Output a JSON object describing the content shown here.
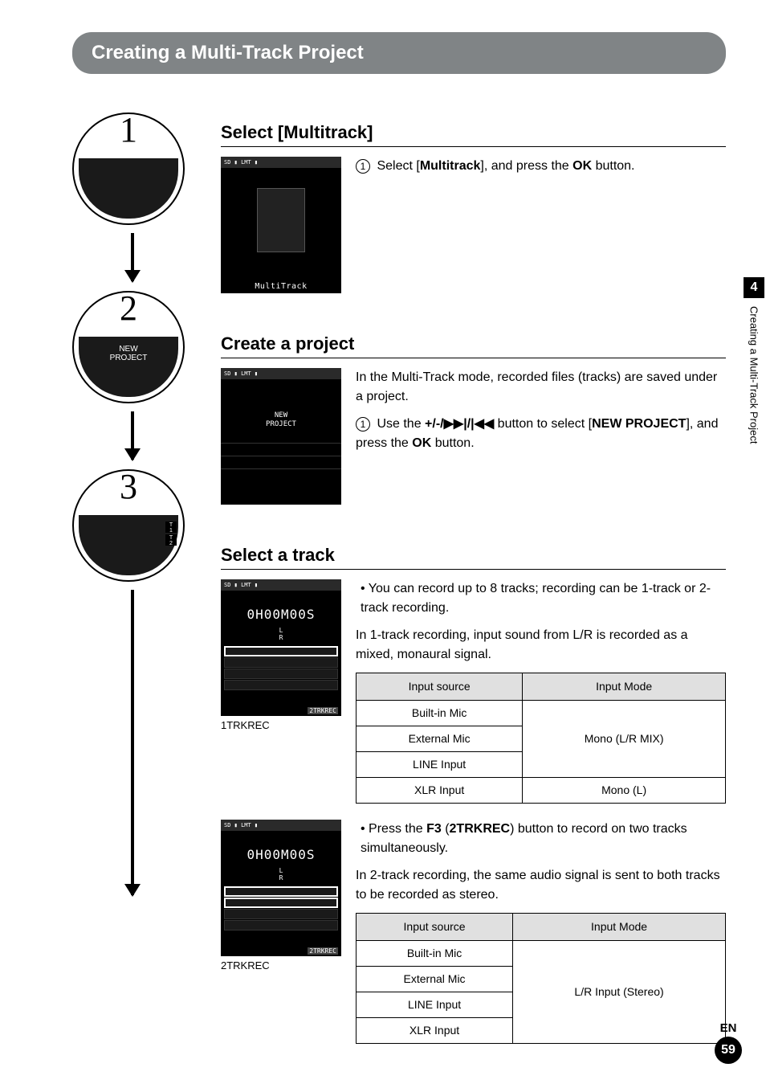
{
  "header": {
    "title": "Creating a Multi-Track Project"
  },
  "side": {
    "chapter_num": "4",
    "chapter_title": "Creating a Multi-Track Project"
  },
  "footer": {
    "lang": "EN",
    "page": "59"
  },
  "steps": {
    "s1": {
      "num": "1"
    },
    "s2": {
      "num": "2",
      "screen_label": "NEW\nPROJECT"
    },
    "s3": {
      "num": "3",
      "t1": "T\n1",
      "t2": "T\n2"
    }
  },
  "sec1": {
    "title": "Select [Multitrack]",
    "screen_footer": "MultiTrack",
    "step_num": "1",
    "text_pre": "Select [",
    "text_bold": "Multitrack",
    "text_mid": "], and press the ",
    "text_ok": "OK",
    "text_post": " button."
  },
  "sec2": {
    "title": "Create a project",
    "intro": "In the Multi-Track mode, recorded files (tracks) are saved under a project.",
    "step_num": "1",
    "text_pre": "Use the ",
    "btn_seq": "+/-/▶▶|/|◀◀",
    "text_mid": " button to select [",
    "text_bold": "NEW PROJECT",
    "text_mid2": "], and press the ",
    "text_ok": "OK",
    "text_post": " button.",
    "screen_np": "NEW\nPROJECT"
  },
  "sec3": {
    "title": "Select a track",
    "bullet1": "You can record up to 8 tracks; recording can be 1-track or 2-track recording.",
    "para1": "In 1-track recording, input sound from L/R is recorded as a mixed, monaural signal.",
    "screen1_time": "0H00M00S",
    "screen1_lr": "L\nR",
    "screen1_bottom": "2TRKREC",
    "cap1": "1TRKREC",
    "bullet2_pre": "Press the ",
    "bullet2_f3": "F3",
    "bullet2_mid": " (",
    "bullet2_bold": "2TRKREC",
    "bullet2_post": ") button to record on two tracks simultaneously.",
    "para2": "In 2-track recording, the same audio signal is sent to both tracks to be recorded as stereo.",
    "screen2_time": "0H00M00S",
    "cap2": "2TRKREC",
    "table1": {
      "h1": "Input source",
      "h2": "Input Mode",
      "r1": "Built-in Mic",
      "r2": "External Mic",
      "r3": "LINE Input",
      "r4": "XLR Input",
      "m1": "Mono (L/R MIX)",
      "m2": "Mono (L)"
    },
    "table2": {
      "h1": "Input source",
      "h2": "Input Mode",
      "r1": "Built-in Mic",
      "r2": "External Mic",
      "r3": "LINE Input",
      "r4": "XLR Input",
      "m1": "L/R Input (Stereo)"
    }
  }
}
